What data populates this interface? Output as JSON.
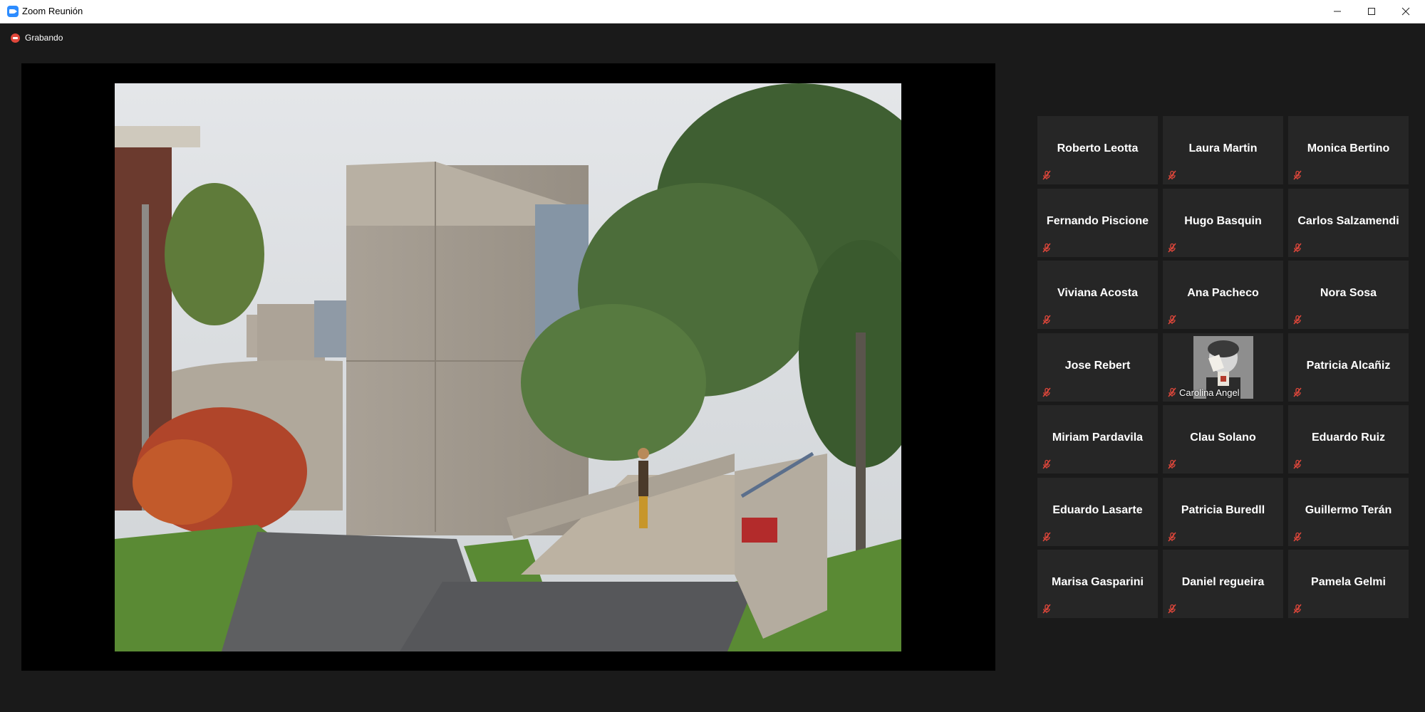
{
  "window": {
    "title": "Zoom Reunión",
    "minimize_icon": "minimize-icon",
    "maximize_icon": "maximize-icon",
    "close_icon": "close-icon"
  },
  "recording": {
    "label": "Grabando",
    "icon": "recording-icon",
    "color": "#e0473b"
  },
  "share": {
    "content": "shared-screen-photo"
  },
  "participants": [
    {
      "name": "Roberto Leotta",
      "muted": true,
      "video": false
    },
    {
      "name": "Laura Martin",
      "muted": true,
      "video": false
    },
    {
      "name": "Monica Bertino",
      "muted": true,
      "video": false
    },
    {
      "name": "Fernando Piscione",
      "muted": true,
      "video": false
    },
    {
      "name": "Hugo Basquin",
      "muted": true,
      "video": false
    },
    {
      "name": "Carlos Salzamendi",
      "muted": true,
      "video": false
    },
    {
      "name": "Viviana Acosta",
      "muted": true,
      "video": false
    },
    {
      "name": "Ana Pacheco",
      "muted": true,
      "video": false
    },
    {
      "name": "Nora Sosa",
      "muted": true,
      "video": false
    },
    {
      "name": "Jose Rebert",
      "muted": true,
      "video": false
    },
    {
      "name": "Carolina Angel",
      "muted": true,
      "video": true
    },
    {
      "name": "Patricia Alcañiz",
      "muted": true,
      "video": false
    },
    {
      "name": "Miriam Pardavila",
      "muted": true,
      "video": false
    },
    {
      "name": "Clau Solano",
      "muted": true,
      "video": false
    },
    {
      "name": "Eduardo Ruiz",
      "muted": true,
      "video": false
    },
    {
      "name": "Eduardo Lasarte",
      "muted": true,
      "video": false
    },
    {
      "name": "Patricia Buredll",
      "muted": true,
      "video": false
    },
    {
      "name": "Guillermo Terán",
      "muted": true,
      "video": false
    },
    {
      "name": "Marisa Gasparini",
      "muted": true,
      "video": false
    },
    {
      "name": "Daniel regueira",
      "muted": true,
      "video": false
    },
    {
      "name": "Pamela Gelmi",
      "muted": true,
      "video": false
    }
  ],
  "colors": {
    "background": "#1a1a1a",
    "tile": "#262626",
    "mute": "#e0473b"
  }
}
